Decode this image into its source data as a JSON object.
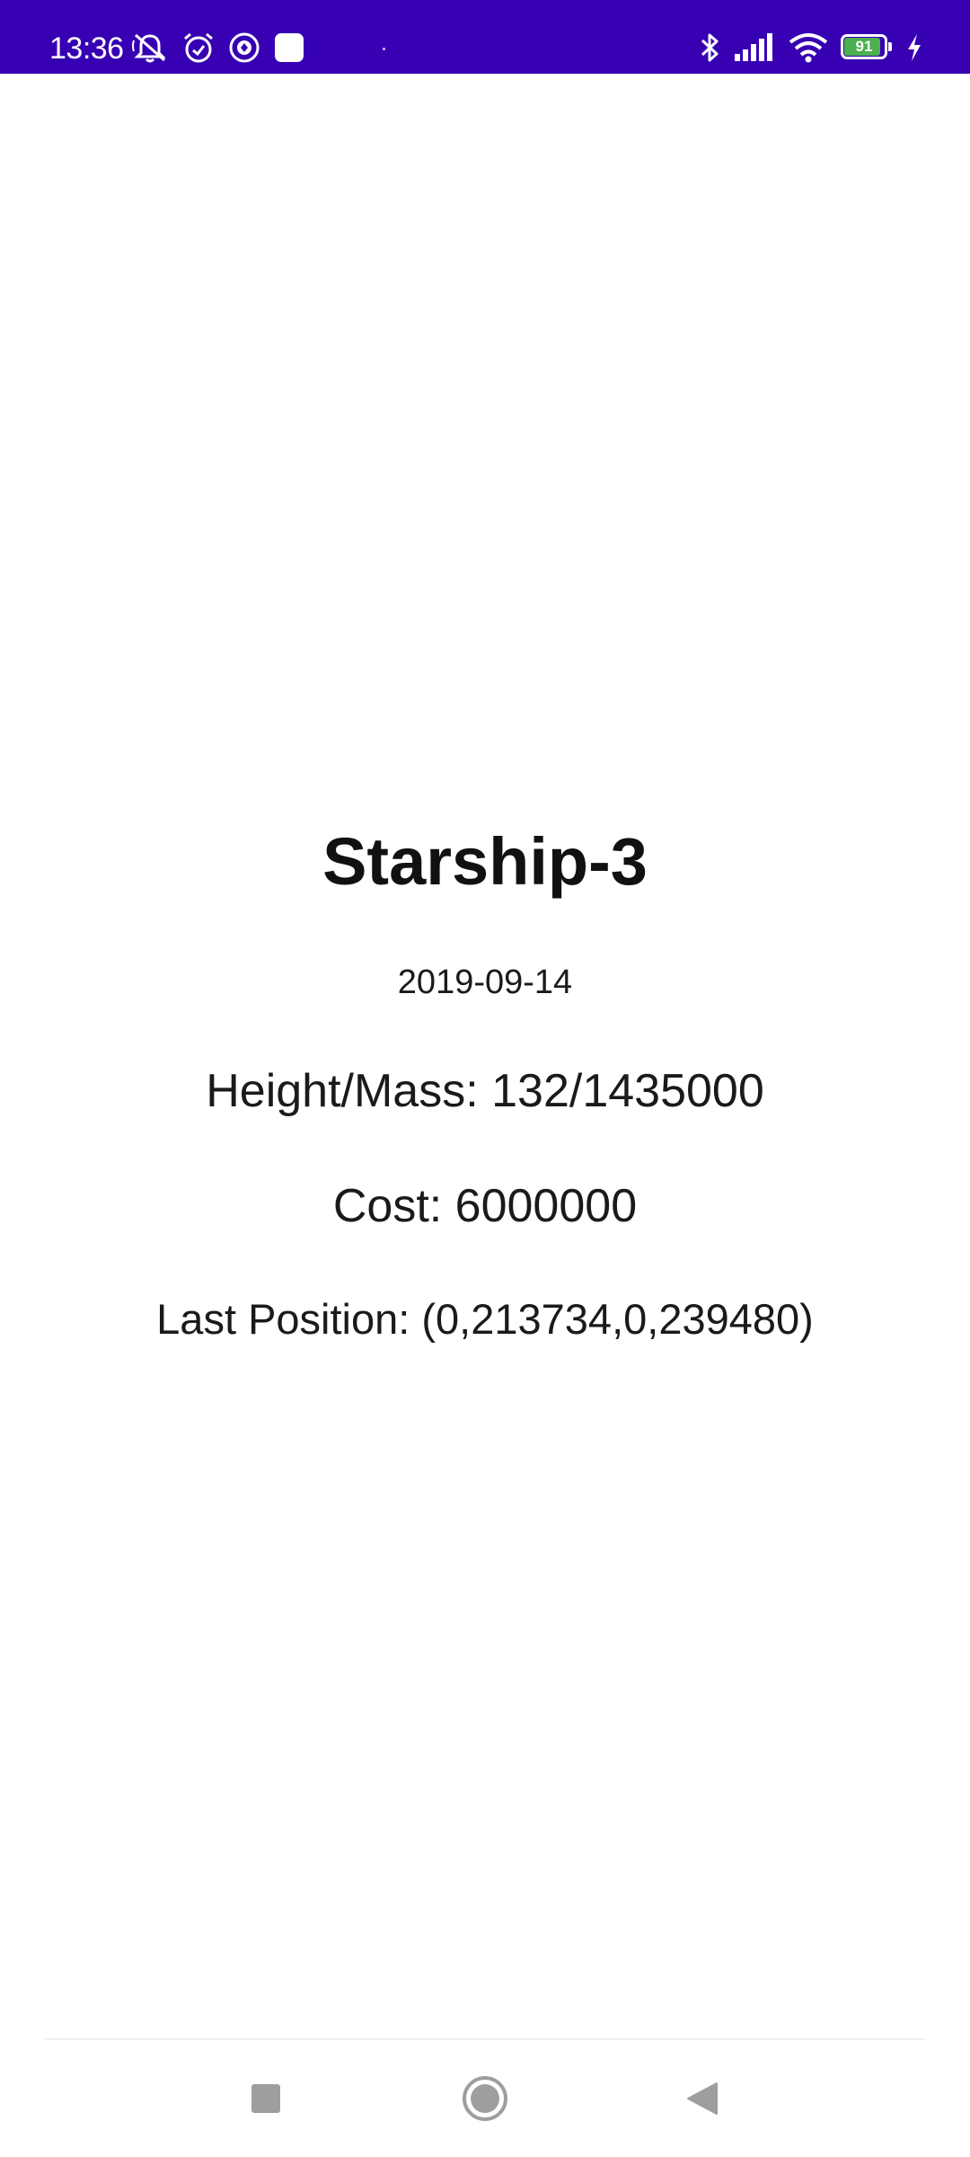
{
  "status_bar": {
    "time": "13:36",
    "battery_percent": "91",
    "background_color": "#3700b3",
    "left_icons": [
      "muted-bell-icon",
      "alarm-icon",
      "app-notification-icon",
      "square-notification-icon"
    ],
    "right_icons": [
      "bluetooth-icon",
      "signal-icon",
      "wifi-icon",
      "battery-icon",
      "charging-icon"
    ]
  },
  "details": {
    "title": "Starship-3",
    "date": "2019-09-14",
    "height_mass": "Height/Mass: 132/1435000",
    "cost": "Cost: 6000000",
    "last_position": "Last Position: (0,213734,0,239480)"
  },
  "nav_bar": {
    "buttons": [
      "recent-apps",
      "home",
      "back"
    ]
  }
}
